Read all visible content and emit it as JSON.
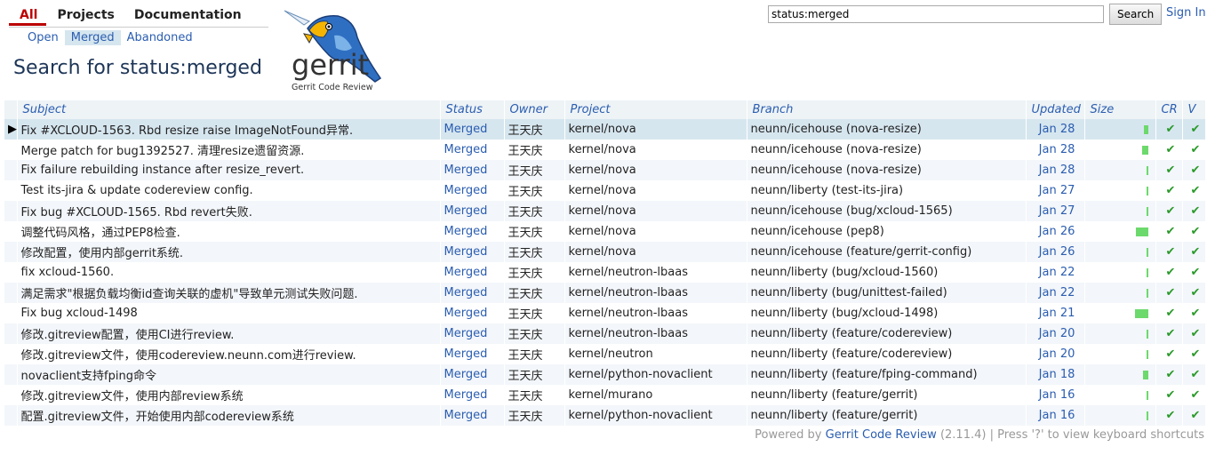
{
  "topmenu": [
    "All",
    "Projects",
    "Documentation"
  ],
  "submenu": [
    "Open",
    "Merged",
    "Abandoned"
  ],
  "page_title": "Search for status:merged",
  "logo": {
    "text": "gerrit",
    "subtitle": "Gerrit Code Review"
  },
  "search": {
    "value": "status:merged",
    "button": "Search"
  },
  "signin": "Sign In",
  "columns": [
    "Subject",
    "Status",
    "Owner",
    "Project",
    "Branch",
    "Updated",
    "Size",
    "CR",
    "V"
  ],
  "rows": [
    {
      "subject": "Fix #XCLOUD-1563. Rbd resize raise ImageNotFound异常.",
      "status": "Merged",
      "owner": "王天庆",
      "project": "kernel/nova",
      "branch": "neunn/icehouse (nova-resize)",
      "updated": "Jan 28",
      "size": 0.3,
      "cr": "✔",
      "v": "✔"
    },
    {
      "subject": "Merge patch for bug1392527. 清理resize遗留资源.",
      "status": "Merged",
      "owner": "王天庆",
      "project": "kernel/nova",
      "branch": "neunn/icehouse (nova-resize)",
      "updated": "Jan 28",
      "size": 0.45,
      "cr": "✔",
      "v": "✔"
    },
    {
      "subject": "Fix failure rebuilding instance after resize_revert.",
      "status": "Merged",
      "owner": "王天庆",
      "project": "kernel/nova",
      "branch": "neunn/icehouse (nova-resize)",
      "updated": "Jan 28",
      "size": 0.15,
      "cr": "✔",
      "v": "✔"
    },
    {
      "subject": "Test its-jira & update codereview config.",
      "status": "Merged",
      "owner": "王天庆",
      "project": "kernel/nova",
      "branch": "neunn/liberty (test-its-jira)",
      "updated": "Jan 27",
      "size": 0.1,
      "cr": "✔",
      "v": "✔"
    },
    {
      "subject": "Fix bug #XCLOUD-1565. Rbd revert失败.",
      "status": "Merged",
      "owner": "王天庆",
      "project": "kernel/nova",
      "branch": "neunn/icehouse (bug/xcloud-1565)",
      "updated": "Jan 27",
      "size": 0.1,
      "cr": "✔",
      "v": "✔"
    },
    {
      "subject": "调整代码风格，通过PEP8检查.",
      "status": "Merged",
      "owner": "王天庆",
      "project": "kernel/nova",
      "branch": "neunn/icehouse (pep8)",
      "updated": "Jan 26",
      "size": 0.85,
      "cr": "✔",
      "v": "✔"
    },
    {
      "subject": "修改配置，使用内部gerrit系统.",
      "status": "Merged",
      "owner": "王天庆",
      "project": "kernel/nova",
      "branch": "neunn/icehouse (feature/gerrit-config)",
      "updated": "Jan 26",
      "size": 0.1,
      "cr": "✔",
      "v": "✔"
    },
    {
      "subject": "fix xcloud-1560.",
      "status": "Merged",
      "owner": "王天庆",
      "project": "kernel/neutron-lbaas",
      "branch": "neunn/liberty (bug/xcloud-1560)",
      "updated": "Jan 22",
      "size": 0.1,
      "cr": "✔",
      "v": "✔"
    },
    {
      "subject": "满足需求\"根据负载均衡id查询关联的虚机\"导致单元测试失败问题.",
      "status": "Merged",
      "owner": "王天庆",
      "project": "kernel/neutron-lbaas",
      "branch": "neunn/liberty (bug/unittest-failed)",
      "updated": "Jan 22",
      "size": 0.1,
      "cr": "✔",
      "v": "✔"
    },
    {
      "subject": "Fix bug xcloud-1498",
      "status": "Merged",
      "owner": "王天庆",
      "project": "kernel/neutron-lbaas",
      "branch": "neunn/liberty (bug/xcloud-1498)",
      "updated": "Jan 21",
      "size": 0.95,
      "cr": "✔",
      "v": "✔"
    },
    {
      "subject": "修改.gitreview配置，使用CI进行review.",
      "status": "Merged",
      "owner": "王天庆",
      "project": "kernel/neutron-lbaas",
      "branch": "neunn/liberty (feature/codereview)",
      "updated": "Jan 20",
      "size": 0.1,
      "cr": "✔",
      "v": "✔"
    },
    {
      "subject": "修改.gitreview文件，使用codereview.neunn.com进行review.",
      "status": "Merged",
      "owner": "王天庆",
      "project": "kernel/neutron",
      "branch": "neunn/liberty (feature/codereview)",
      "updated": "Jan 20",
      "size": 0.1,
      "cr": "✔",
      "v": "✔"
    },
    {
      "subject": "novaclient支持fping命令",
      "status": "Merged",
      "owner": "王天庆",
      "project": "kernel/python-novaclient",
      "branch": "neunn/liberty (feature/fping-command)",
      "updated": "Jan 18",
      "size": 0.35,
      "cr": "✔",
      "v": "✔"
    },
    {
      "subject": "修改.gitreview文件，使用内部review系统",
      "status": "Merged",
      "owner": "王天庆",
      "project": "kernel/murano",
      "branch": "neunn/liberty (feature/gerrit)",
      "updated": "Jan 16",
      "size": 0.1,
      "cr": "✔",
      "v": "✔"
    },
    {
      "subject": "配置.gitreview文件，开始使用内部codereview系统",
      "status": "Merged",
      "owner": "王天庆",
      "project": "kernel/python-novaclient",
      "branch": "neunn/liberty (feature/gerrit)",
      "updated": "Jan 16",
      "size": 0.1,
      "cr": "✔",
      "v": "✔"
    }
  ],
  "footer": {
    "prefix": "Powered by",
    "link": "Gerrit Code Review",
    "version": "(2.11.4)",
    "sep": "|",
    "shortcuts": "Press '?' to view keyboard shortcuts"
  },
  "colors": {
    "accent": "#2a5db0",
    "active_tab": "#bb0000",
    "check": "#2a9a2a",
    "size_bar": "#6cd96c"
  }
}
